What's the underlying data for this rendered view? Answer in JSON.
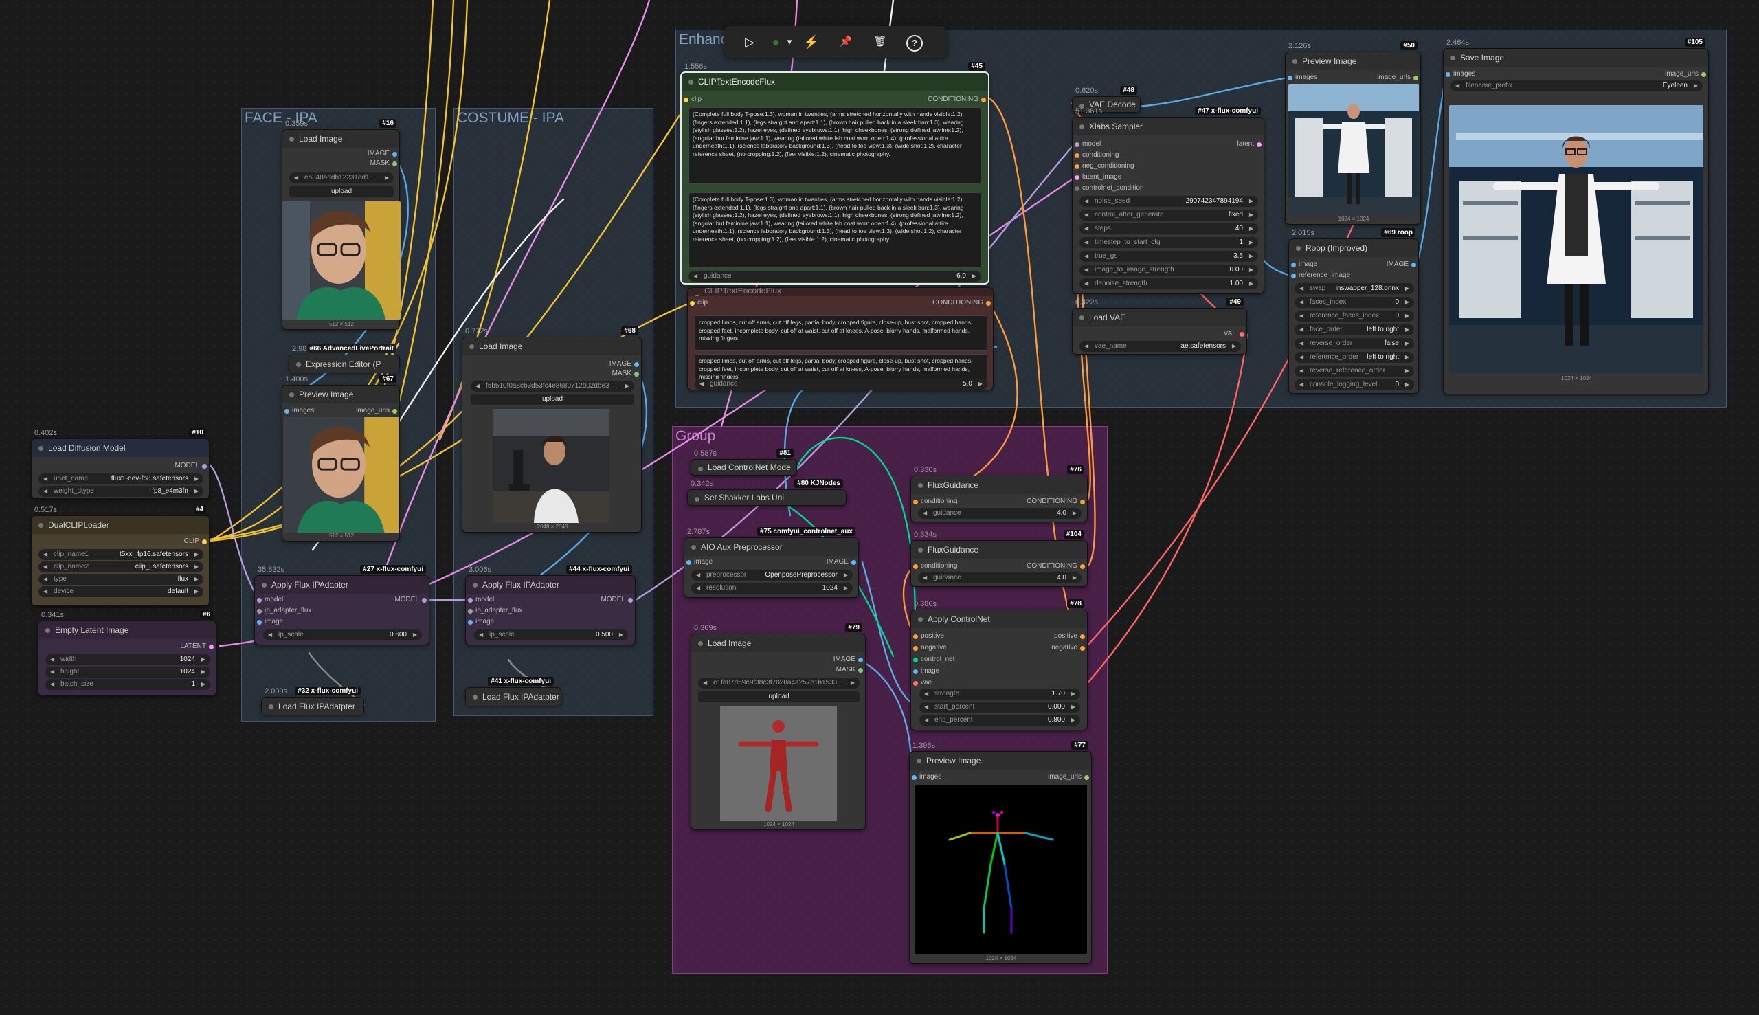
{
  "groups": [
    {
      "id": "enhance",
      "title": "Enhanc",
      "color": "#4c6a8a"
    },
    {
      "id": "face",
      "title": "FACE - IPA",
      "color": "#4c6a8a"
    },
    {
      "id": "costume",
      "title": "COSTUME - IPA",
      "color": "#4c6a8a"
    },
    {
      "id": "group",
      "title": "Group",
      "color": "#b04cb0"
    }
  ],
  "toolbar": {
    "run": "▷",
    "color": "●",
    "chevron": "▾",
    "wand": "⚡",
    "pin": "📌",
    "trash": "🗑",
    "help": "?"
  },
  "nodes": {
    "load_diffusion": {
      "time": "0.402s",
      "id": "#10",
      "title": "Load Diffusion Model",
      "out": "MODEL",
      "w": [
        {
          "l": "unet_name",
          "v": "flux1-dev-fp8.safetensors"
        },
        {
          "l": "weight_dtype",
          "v": "fp8_e4m3fn"
        }
      ]
    },
    "dualclip": {
      "time": "0.517s",
      "id": "#4",
      "title": "DualCLIPLoader",
      "out": "CLIP",
      "w": [
        {
          "l": "clip_name1",
          "v": "t5xxl_fp16.safetensors"
        },
        {
          "l": "clip_name2",
          "v": "clip_l.safetensors"
        },
        {
          "l": "type",
          "v": "flux"
        },
        {
          "l": "device",
          "v": "default"
        }
      ]
    },
    "empty_latent": {
      "time": "0.341s",
      "id": "#6",
      "title": "Empty Latent Image",
      "out": "LATENT",
      "w": [
        {
          "l": "width",
          "v": "1024"
        },
        {
          "l": "height",
          "v": "1024"
        },
        {
          "l": "batch_size",
          "v": "1"
        }
      ]
    },
    "load_image_face": {
      "time": "0.359s",
      "id": "#16",
      "title": "Load Image",
      "out1": "IMAGE",
      "out2": "MASK",
      "file": "eb348addb12231ed1 ...",
      "upload": "upload",
      "dim": "512 × 512"
    },
    "expression": {
      "time": "2.981s",
      "id": "#66 AdvancedLivePortrait",
      "title": "Expression Editor (P"
    },
    "preview_face": {
      "time": "1.400s",
      "id": "#67",
      "title": "Preview Image",
      "in": "images",
      "out": "image_urls",
      "dim": "512 × 512"
    },
    "apply_ipa_face": {
      "time": "35.832s",
      "id": "#27 x-flux-comfyui",
      "title": "Apply Flux IPAdapter",
      "in": [
        "model",
        "ip_adapter_flux",
        "image"
      ],
      "out": "MODEL",
      "w": [
        {
          "l": "ip_scale",
          "v": "0.600"
        }
      ]
    },
    "load_ipa_face": {
      "time": "2.000s",
      "id": "#32 x-flux-comfyui",
      "title": "Load Flux IPAdatpter"
    },
    "load_image_costume": {
      "time": "0.772s",
      "id": "#68",
      "title": "Load Image",
      "out1": "IMAGE",
      "out2": "MASK",
      "file": "f5b510f0a8cb3d53fc4e8680712d02dbe3 ...",
      "upload": "upload",
      "dim": "2048 × 2048"
    },
    "apply_ipa_costume": {
      "time": "3.006s",
      "id": "#44 x-flux-comfyui",
      "title": "Apply Flux IPAdapter",
      "in": [
        "model",
        "ip_adapter_flux",
        "image"
      ],
      "out": "MODEL",
      "w": [
        {
          "l": "ip_scale",
          "v": "0.500"
        }
      ]
    },
    "load_ipa_costume": {
      "id": "#41 x-flux-comfyui",
      "title": "Load Flux IPAdatpter"
    },
    "clip_pos": {
      "time": "1.556s",
      "id": "#45",
      "title": "CLIPTextEncodeFlux",
      "in": "clip",
      "out": "CONDITIONING",
      "text1": "(Complete full body T-pose:1.3), woman in twenties, (arms stretched horizontally with hands visible:1.2), (fingers extended:1.1), (legs straight and apart:1.1), (brown hair pulled back in a sleek bun:1.3), wearing (stylish glasses:1.2), hazel eyes, (defined eyebrows:1.1), high cheekbones, (strong defined jawline:1.2), (angular but feminine jaw:1.1), wearing (tailored white lab coat worn open:1.4), (professional attire underneath:1.1), (science laboratory background:1.3), (head to toe view:1.3), (wide shot:1.2), character reference sheet, (no cropping:1.2), (feet visible:1.2), cinematic photography.",
      "text2": "(Complete full body T-pose:1.3), woman in twenties, (arms stretched horizontally with hands visible:1.2), (fingers extended:1.1), (legs straight and apart:1.1), (brown hair pulled back in a sleek bun:1.3), wearing (stylish glasses:1.2), hazel eyes, (defined eyebrows:1.1), high cheekbones, (strong defined jawline:1.2), (angular but feminine jaw:1.1), wearing (tailored white lab coat worn open:1.4), (professional attire underneath:1.1), (science laboratory background:1.3), (head to toe view:1.3), (wide shot:1.2), character reference sheet, (no cropping:1.2), (feet visible:1.2), cinematic photography.",
      "w": [
        {
          "l": "guidance",
          "v": "6.0"
        }
      ]
    },
    "clip_neg": {
      "title": "CLIPTextEncodeFlux",
      "in": "clip",
      "out": "CONDITIONING",
      "text1": "cropped limbs, cut off arms, cut off legs, partial body, cropped figure, close-up, bust shot, cropped hands, cropped feet, incomplete body, cut off at waist, cut off at knees, A-pose, blurry hands, malformed hands, missing fingers.",
      "text2": "cropped limbs, cut off arms, cut off legs, partial body, cropped figure, close-up, bust shot, cropped hands, cropped feet, incomplete body, cut off at waist, cut off at knees, A-pose, blurry hands, malformed hands, missing fingers.",
      "w": [
        {
          "l": "guidance",
          "v": "5.0"
        }
      ]
    },
    "vae_decode": {
      "time": "0.620s",
      "id": "#48",
      "title": "VAE Decode"
    },
    "xlabs": {
      "time": "51.361s",
      "id": "#47 x-flux-comfyui",
      "title": "Xlabs Sampler",
      "in": [
        "model",
        "conditioning",
        "neg_conditioning",
        "latent_image",
        "controlnet_condition"
      ],
      "out": "latent",
      "w": [
        {
          "l": "noise_seed",
          "v": "290742347894194"
        },
        {
          "l": "control_after_generate",
          "v": "fixed"
        },
        {
          "l": "steps",
          "v": "40"
        },
        {
          "l": "timestep_to_start_cfg",
          "v": "1"
        },
        {
          "l": "true_gs",
          "v": "3.5"
        },
        {
          "l": "image_to_image_strength",
          "v": "0.00"
        },
        {
          "l": "denoise_strength",
          "v": "1.00"
        }
      ]
    },
    "load_vae": {
      "time": "0.422s",
      "id": "#49",
      "title": "Load VAE",
      "out": "VAE",
      "w": [
        {
          "l": "vae_name",
          "v": "ae.safetensors"
        }
      ]
    },
    "preview_top": {
      "time": "2.126s",
      "id": "#50",
      "title": "Preview Image",
      "in": "images",
      "out": "image_urls",
      "dim": "1024 × 1024"
    },
    "reactor": {
      "time": "2.015s",
      "id": "#69 roop",
      "title": "Roop (Improved)",
      "in": [
        "image",
        "reference_image"
      ],
      "out": "IMAGE",
      "w": [
        {
          "l": "swap",
          "v": "inswapper_128.onnx"
        },
        {
          "l": "faces_index",
          "v": "0"
        },
        {
          "l": "reference_faces_index",
          "v": "0"
        },
        {
          "l": "face_order",
          "v": "left to right"
        },
        {
          "l": "reverse_order",
          "v": "false"
        },
        {
          "l": "reference_order",
          "v": "left to right"
        },
        {
          "l": "reverse_reference_order",
          "v": "false"
        },
        {
          "l": "console_logging_level",
          "v": "0"
        }
      ]
    },
    "save_image": {
      "time": "2.464s",
      "id": "#105",
      "title": "Save Image",
      "in": "images",
      "out": "image_urls",
      "w": [
        {
          "l": "filename_prefix",
          "v": "Eyeleen"
        }
      ],
      "dim": "1024 × 1024"
    },
    "load_cn_model": {
      "time": "0.587s",
      "id": "#81",
      "title": "Load ControlNet Mode"
    },
    "set_shakker": {
      "time": "0.342s",
      "id": "#80 KJNodes",
      "title": "Set Shakker Labs Uni"
    },
    "aio_aux": {
      "time": "2.787s",
      "id": "#75 comfyui_controlnet_aux",
      "title": "AIO Aux Preprocessor",
      "in": "image",
      "out": "IMAGE",
      "w": [
        {
          "l": "preprocessor",
          "v": "OpenposePreprocessor"
        },
        {
          "l": "resolution",
          "v": "1024"
        }
      ]
    },
    "load_image_pose": {
      "time": "0.369s",
      "id": "#79",
      "title": "Load Image",
      "out1": "IMAGE",
      "out2": "MASK",
      "file": "e1fa87d59e9f38c3f7028a4a257e1b1533 ...",
      "upload": "upload",
      "dim": "1024 × 1024"
    },
    "flux_guid1": {
      "time": "0.330s",
      "id": "#76",
      "title": "FluxGuidance",
      "in": "conditioning",
      "out": "CONDITIONING",
      "w": [
        {
          "l": "guidance",
          "v": "4.0"
        }
      ]
    },
    "flux_guid2": {
      "time": "0.334s",
      "id": "#104",
      "title": "FluxGuidance",
      "in": "conditioning",
      "out": "CONDITIONING",
      "w": [
        {
          "l": "guidance",
          "v": "4.0"
        }
      ]
    },
    "apply_cn": {
      "time": "0.386s",
      "id": "#78",
      "title": "Apply ControlNet",
      "in": [
        "positive",
        "negative",
        "control_net",
        "image",
        "vae"
      ],
      "out": [
        "positive",
        "negative"
      ],
      "w": [
        {
          "l": "strength",
          "v": "1.70"
        },
        {
          "l": "start_percent",
          "v": "0.000"
        },
        {
          "l": "end_percent",
          "v": "0.800"
        }
      ]
    },
    "preview_pose": {
      "time": "1.396s",
      "id": "#77",
      "title": "Preview Image",
      "in": "images",
      "out": "image_urls",
      "dim": "1024 × 1024"
    }
  },
  "colors": {
    "model": "#b39ddb",
    "clip": "#ffd54f",
    "conditioning": "#ffa040",
    "image": "#64b5f6",
    "latent": "#ff9cf9",
    "vae": "#ff6e6e",
    "mask": "#81c784",
    "controlnet": "#00d68f"
  }
}
